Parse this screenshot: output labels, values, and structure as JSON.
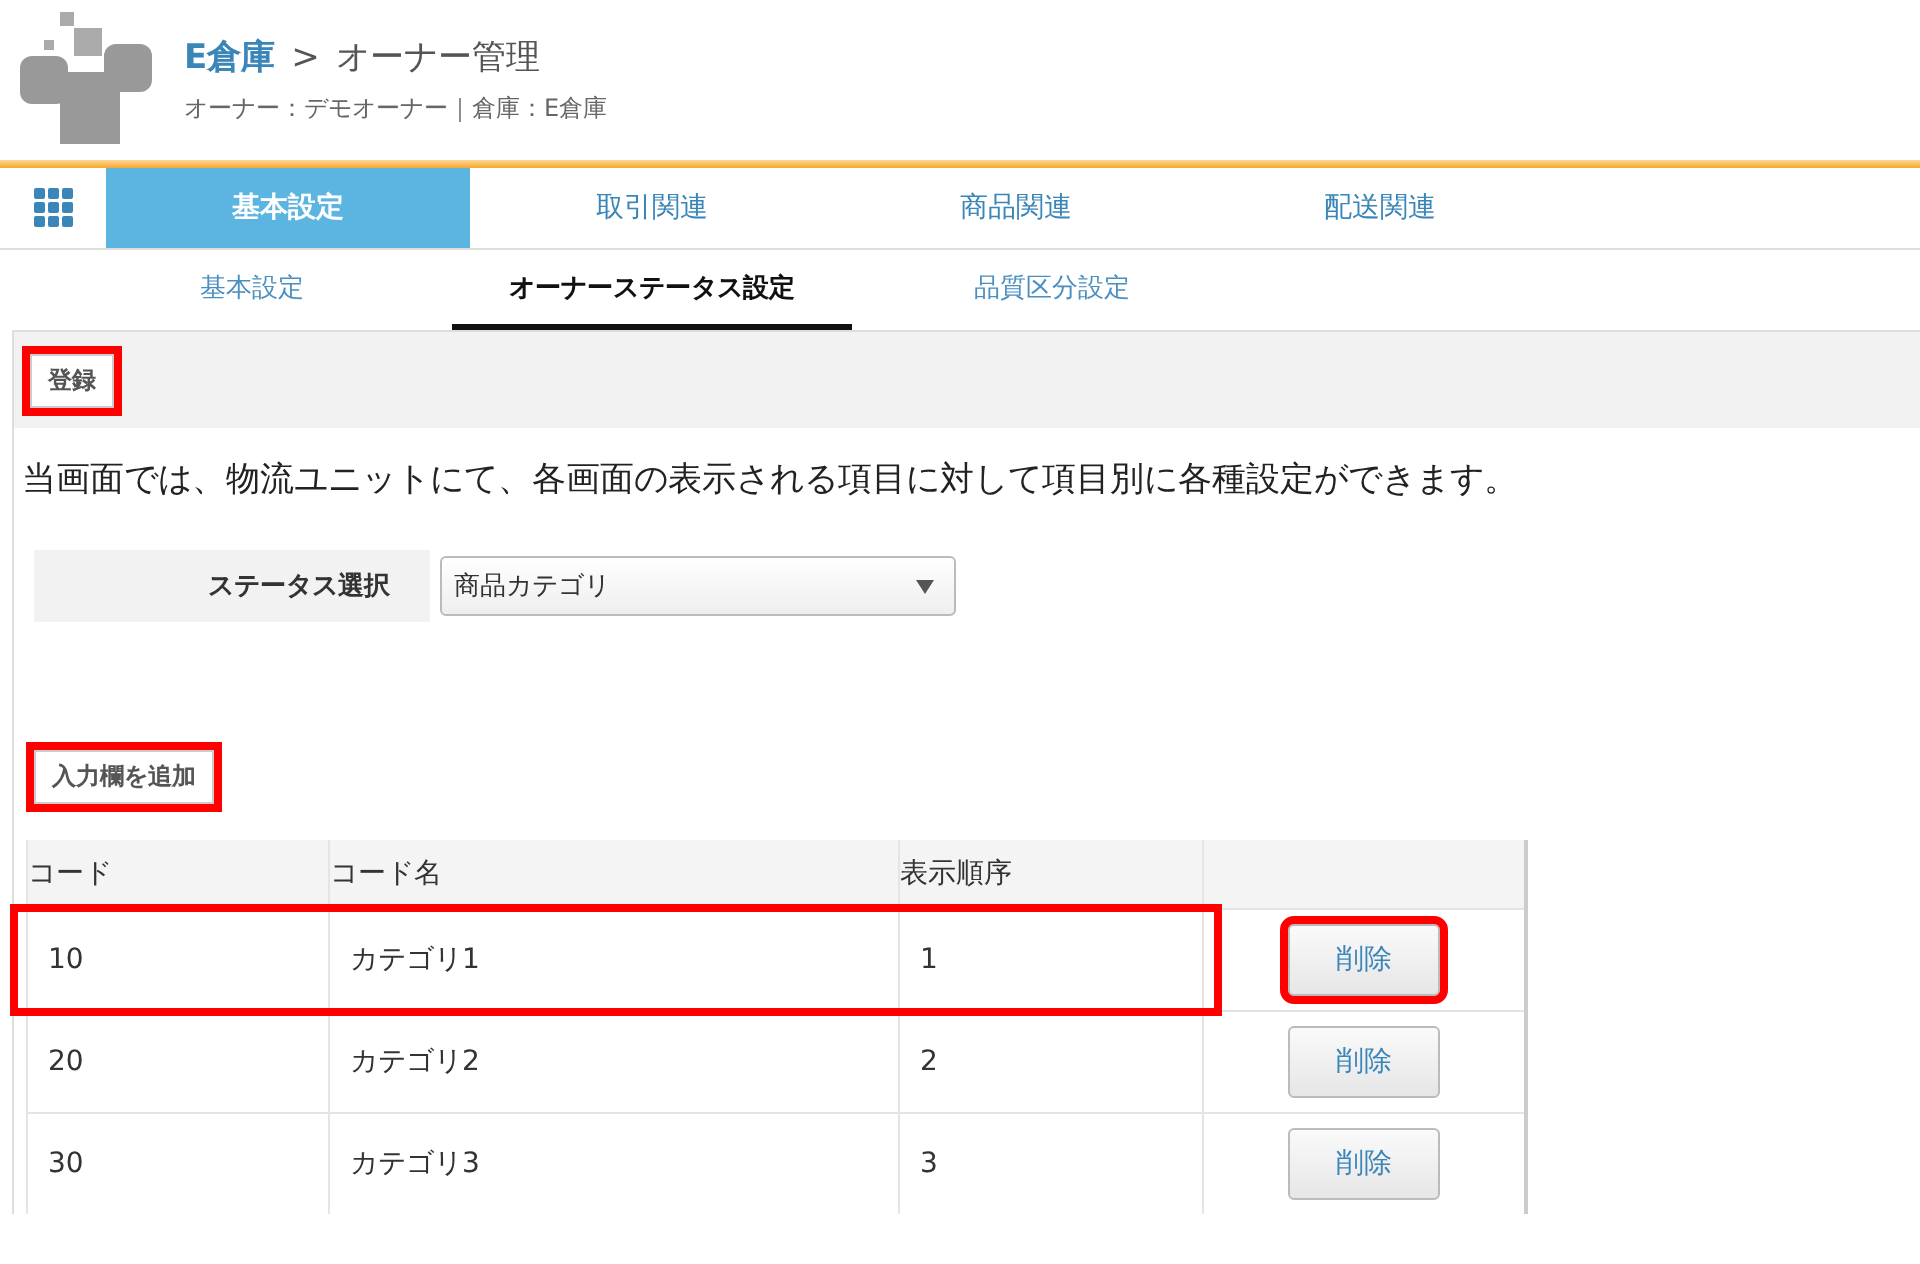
{
  "header": {
    "warehouse": "E倉庫",
    "separator": ">",
    "page_title": "オーナー管理",
    "subtitle": "オーナー：デモオーナー｜倉庫：E倉庫"
  },
  "main_tabs": [
    {
      "label": "基本設定",
      "selected": true
    },
    {
      "label": "取引関連",
      "selected": false
    },
    {
      "label": "商品関連",
      "selected": false
    },
    {
      "label": "配送関連",
      "selected": false
    }
  ],
  "sub_tabs": [
    {
      "label": "基本設定",
      "selected": false
    },
    {
      "label": "オーナーステータス設定",
      "selected": true
    },
    {
      "label": "品質区分設定",
      "selected": false
    }
  ],
  "toolbar": {
    "register_button": {
      "label": "登録",
      "highlighted": true
    }
  },
  "description": "当画面では、物流ユニットにて、各画面の表示される項目に対して項目別に各種設定ができます。",
  "status_select": {
    "label": "ステータス選択",
    "value": "商品カテゴリ"
  },
  "add_button": {
    "label": "入力欄を追加",
    "highlighted": true
  },
  "table": {
    "columns": [
      "コード",
      "コード名",
      "表示順序"
    ],
    "rows": [
      {
        "cells": [
          "10",
          "カテゴリ1",
          "1"
        ],
        "delete": "削除",
        "highlighted": true,
        "delete_highlighted": true
      },
      {
        "cells": [
          "20",
          "カテゴリ2",
          "2"
        ],
        "delete": "削除",
        "highlighted": false,
        "delete_highlighted": false
      },
      {
        "cells": [
          "30",
          "カテゴリ3",
          "3"
        ],
        "delete": "削除",
        "highlighted": false,
        "delete_highlighted": false
      }
    ]
  }
}
